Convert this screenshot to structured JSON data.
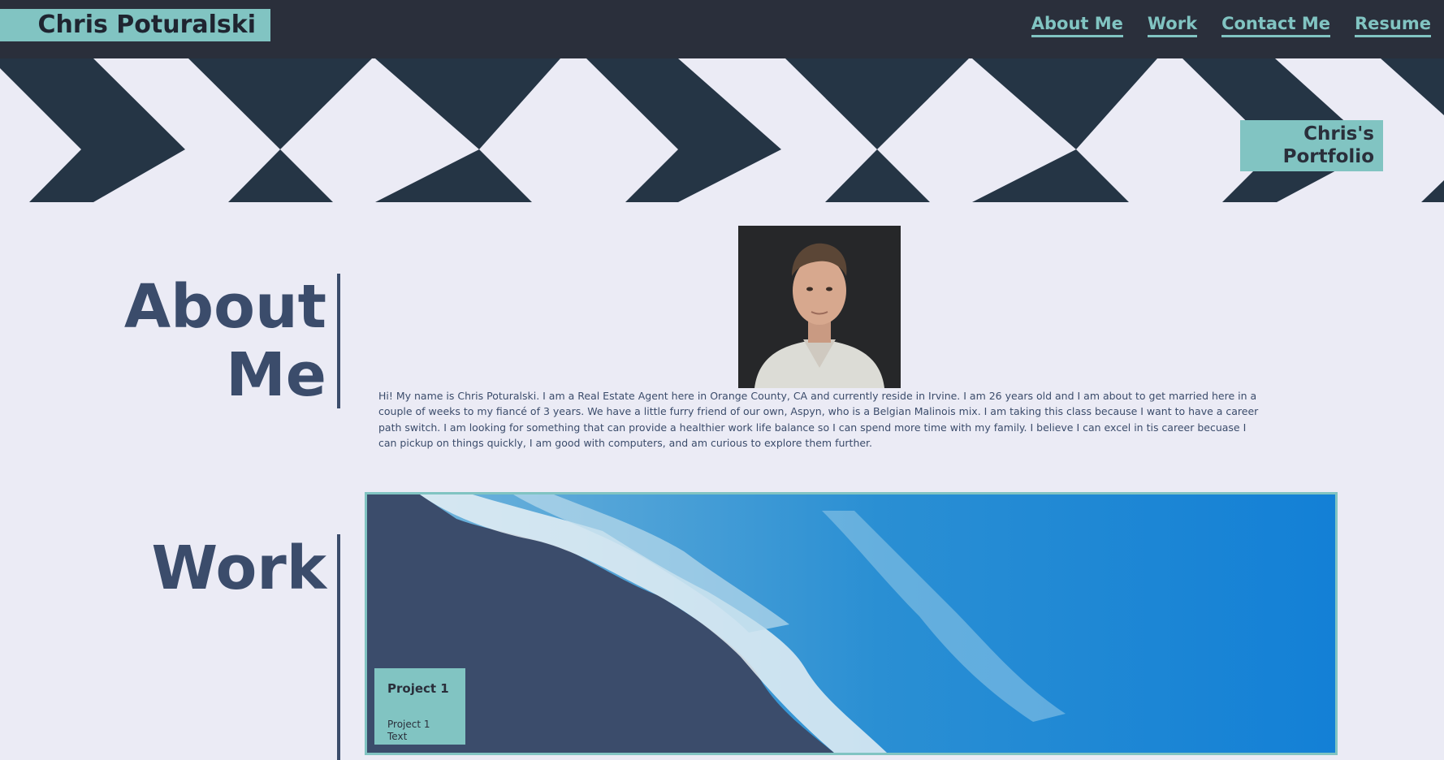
{
  "header": {
    "brand": "Chris Poturalski",
    "nav": [
      "About Me",
      "Work",
      "Contact Me",
      "Resume"
    ]
  },
  "hero": {
    "badge": "Chris's Portfolio"
  },
  "about": {
    "title": "About Me",
    "bio": "Hi! My name is Chris Poturalski. I am a Real Estate Agent here in Orange County, CA and currently reside in Irvine. I am 26 years old and I am about to get married here in a couple of weeks to my fiancé of 3 years. We have a little furry friend of our own, Aspyn, who is a Belgian Malinois mix. I am taking this class because I want to have a career path switch. I am looking for something that can provide a healthier work life balance so I can spend more time with my family. I believe I can excel in tis career becuase I can pickup on things quickly, I am good with computers, and am curious to explore them further."
  },
  "work": {
    "title": "Work",
    "projects": [
      {
        "title": "Project 1",
        "text": "Project 1 Text"
      }
    ]
  },
  "colors": {
    "header_bg": "#2a2f3b",
    "accent_teal": "#81c4c2",
    "navy": "#3b4c6b",
    "page_bg": "#ebebf5",
    "hero_dark": "#253545"
  },
  "icons": {
    "hero_pattern": "chevron-pattern",
    "profile_photo": "portrait-photo",
    "work_image": "ocean-coast-image"
  }
}
